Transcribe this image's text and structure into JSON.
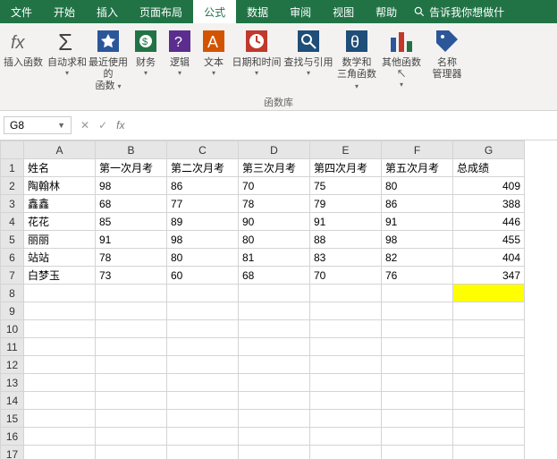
{
  "menu": {
    "tabs": [
      "文件",
      "开始",
      "插入",
      "页面布局",
      "公式",
      "数据",
      "审阅",
      "视图",
      "帮助"
    ],
    "active_index": 4,
    "tell_me": "告诉我你想做什"
  },
  "ribbon": {
    "insert_fn": "插入函数",
    "autosum": "自动求和",
    "recent1": "最近使用的",
    "recent2": "函数",
    "financial": "财务",
    "logical": "逻辑",
    "text": "文本",
    "date_time": "日期和时间",
    "lookup": "查找与引用",
    "math1": "数学和",
    "math2": "三角函数",
    "more": "其他函数",
    "name_mgr1": "名称",
    "name_mgr2": "管理器",
    "group_label": "函数库"
  },
  "formula_bar": {
    "name_box": "G8",
    "fx": "fx",
    "value": ""
  },
  "columns": [
    "A",
    "B",
    "C",
    "D",
    "E",
    "F",
    "G"
  ],
  "row_count": 17,
  "selected": {
    "row": 8,
    "col": "G"
  },
  "data": {
    "1": {
      "A": "姓名",
      "B": "第一次月考",
      "C": "第二次月考",
      "D": "第三次月考",
      "E": "第四次月考",
      "F": "第五次月考",
      "G": "总成绩"
    },
    "2": {
      "A": "陶翰林",
      "B": "98",
      "C": "86",
      "D": "70",
      "E": "75",
      "F": "80",
      "G": "409"
    },
    "3": {
      "A": "鑫鑫",
      "B": "68",
      "C": "77",
      "D": "78",
      "E": "79",
      "F": "86",
      "G": "388"
    },
    "4": {
      "A": "花花",
      "B": "85",
      "C": "89",
      "D": "90",
      "E": "91",
      "F": "91",
      "G": "446"
    },
    "5": {
      "A": "丽丽",
      "B": "91",
      "C": "98",
      "D": "80",
      "E": "88",
      "F": "98",
      "G": "455"
    },
    "6": {
      "A": "站站",
      "B": "78",
      "C": "80",
      "D": "81",
      "E": "83",
      "F": "82",
      "G": "404"
    },
    "7": {
      "A": "白梦玉",
      "B": "73",
      "C": "60",
      "D": "68",
      "E": "70",
      "F": "76",
      "G": "347"
    }
  }
}
